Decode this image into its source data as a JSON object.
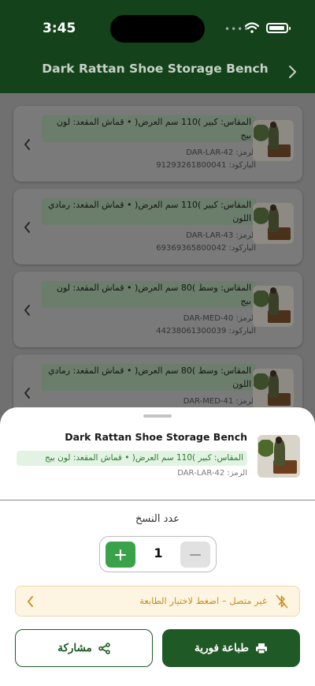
{
  "status_bar": {
    "time": "3:45",
    "signal_dots": "••••"
  },
  "header": {
    "title": "Dark Rattan Shoe Storage Bench"
  },
  "variants": [
    {
      "spec": "المقاس: كبير )110 سم العرض( • قماش المقعد: لون بيج",
      "code": "الرمز: DAR-LAR-42",
      "barcode": "الباركود: 91293261800041"
    },
    {
      "spec": "المقاس: كبير )110 سم العرض( • قماش المقعد: رمادي اللون",
      "code": "الرمز: DAR-LAR-43",
      "barcode": "الباركود: 69369365800042"
    },
    {
      "spec": "المقاس: وسط )80 سم العرض( • قماش المقعد: لون بيج",
      "code": "الرمز: DAR-MED-40",
      "barcode": "الباركود: 44238061300039"
    },
    {
      "spec": "المقاس: وسط )80 سم العرض( • قماش المقعد: رمادي اللون",
      "code": "الرمز: DAR-MED-41",
      "barcode": ""
    }
  ],
  "sheet": {
    "product_title": "Dark Rattan Shoe Storage Bench",
    "spec": "المقاس: كبير )110 سم العرض( • قماش المقعد: لون بيج",
    "code": "الرمز: DAR-LAR-42",
    "copies_label": "عدد النسخ",
    "copies_value": "1",
    "printer_alert": "غير متصل – اضغط لاختيار الطابعة",
    "share_label": "مشاركة",
    "print_label": "طباعة فورية"
  },
  "colors": {
    "header_bg": "#14421a",
    "primary": "#1f5a26",
    "plus_green": "#3aa34a",
    "alert_bg": "#fdf4e1",
    "alert_text": "#c8901d",
    "spec_bg": "#e3f3e3"
  },
  "icons": {
    "header": "chevron-right-icon",
    "alert": "bluetooth-off-icon",
    "share": "share-icon",
    "print": "printer-icon"
  }
}
